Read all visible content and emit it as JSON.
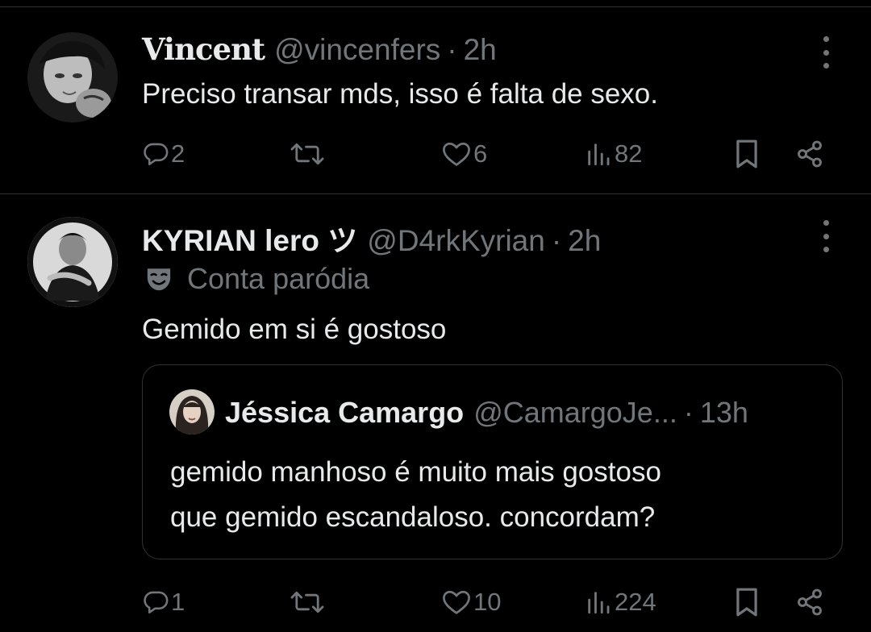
{
  "tweets": [
    {
      "name": "Vincent",
      "handle": "@vincenfers",
      "separator": "·",
      "time": "2h",
      "text": "Preciso transar mds, isso é falta de sexo.",
      "replies": "2",
      "likes": "6",
      "views": "82"
    },
    {
      "name": "KYRIAN lero ツ",
      "handle": "@D4rkKyrian",
      "separator": "·",
      "time": "2h",
      "label": "Conta paródia",
      "text": "Gemido em si é gostoso",
      "replies": "1",
      "likes": "10",
      "views": "224",
      "quote": {
        "name": "Jéssica Camargo",
        "handle": "@CamargoJe...",
        "separator": "·",
        "time": "13h",
        "text_line1": "gemido manhoso é muito mais gostoso",
        "text_line2": "que gemido escandaloso. concordam?"
      }
    }
  ],
  "colors": {
    "background": "#000000",
    "text": "#e7e9ea",
    "secondary": "#71767b",
    "divider": "#2f3336"
  },
  "icons": [
    "reply-icon",
    "retweet-icon",
    "like-icon",
    "views-icon",
    "bookmark-icon",
    "share-icon",
    "more-icon",
    "parody-mask-icon"
  ]
}
